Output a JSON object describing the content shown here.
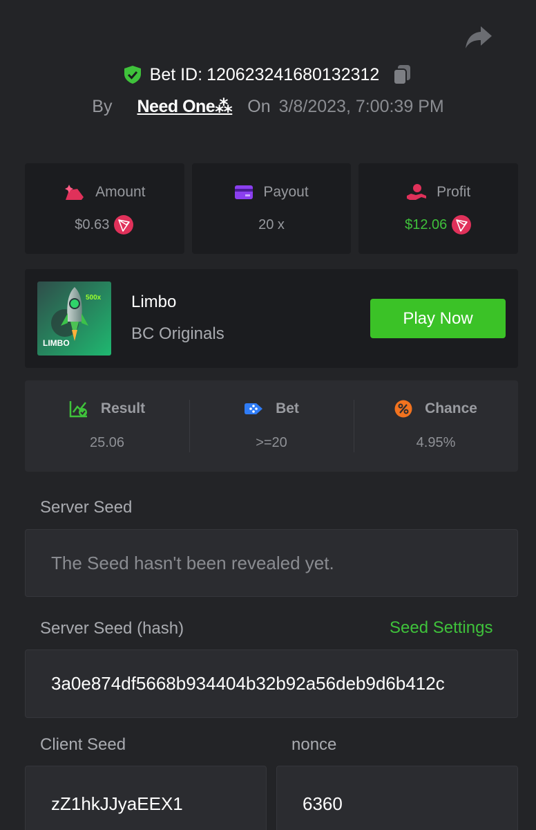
{
  "header": {
    "bet_id_label": "Bet ID:",
    "bet_id": "120623241680132312",
    "by_label": "By",
    "username": "Need One⁂",
    "on_label": "On",
    "datetime": "3/8/2023, 7:00:39 PM"
  },
  "stats": {
    "amount_label": "Amount",
    "amount_value": "$0.63",
    "payout_label": "Payout",
    "payout_value": "20 x",
    "profit_label": "Profit",
    "profit_value": "$12.06"
  },
  "game": {
    "name": "Limbo",
    "provider": "BC Originals",
    "play_label": "Play Now",
    "thumb_multiplier": "500x",
    "thumb_title": "LIMBO"
  },
  "details": {
    "result_label": "Result",
    "result_value": "25.06",
    "bet_label": "Bet",
    "bet_value": ">=20",
    "chance_label": "Chance",
    "chance_value": "4.95%"
  },
  "seeds": {
    "server_seed_label": "Server Seed",
    "server_seed_value": "The Seed hasn't been revealed yet.",
    "server_hash_label": "Server Seed (hash)",
    "seed_settings_label": "Seed Settings",
    "server_hash_value": "3a0e874df5668b934404b32b92a56deb9d6b412c",
    "client_seed_label": "Client Seed",
    "client_seed_value": "zZ1hkJJyaEEX1",
    "nonce_label": "nonce",
    "nonce_value": "6360"
  },
  "colors": {
    "background": "#232427",
    "card": "#1b1c1f",
    "accent_green": "#3bc227",
    "coin_red": "#e0315a"
  },
  "icons": [
    "share-icon",
    "shield-check-icon",
    "copy-icon",
    "amount-icon",
    "payout-card-icon",
    "profit-icon",
    "tron-coin-icon",
    "result-chart-icon",
    "bet-dice-icon",
    "chance-percent-icon"
  ]
}
